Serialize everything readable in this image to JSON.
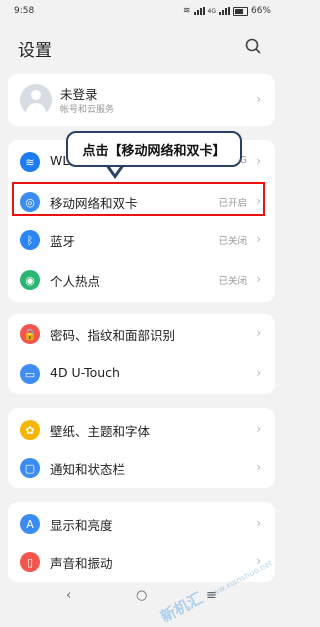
{
  "status_bar": {
    "time": "9:58",
    "network": "4G",
    "battery": "66%"
  },
  "page": {
    "title": "设置"
  },
  "account": {
    "name": "未登录",
    "subtitle": "帐号和云服务"
  },
  "network_group": {
    "wlan": {
      "label": "WLAN",
      "status": "G"
    },
    "mobile": {
      "label": "移动网络和双卡",
      "status": "已开启"
    },
    "bluetooth": {
      "label": "蓝牙",
      "status": "已关闭"
    },
    "hotspot": {
      "label": "个人热点",
      "status": "已关闭"
    }
  },
  "security_group": {
    "password": {
      "label": "密码、指纹和面部识别"
    },
    "utouch": {
      "label": "4D U-Touch"
    }
  },
  "display_group": {
    "wallpaper": {
      "label": "壁纸、主题和字体"
    },
    "notifications": {
      "label": "通知和状态栏"
    }
  },
  "sound_group": {
    "display": {
      "label": "显示和亮度"
    },
    "sound": {
      "label": "声音和振动"
    }
  },
  "annotation": {
    "callout": "点击【移动网络和双卡】"
  },
  "watermark": {
    "text": "新机汇",
    "sub": "www.xianshuo.net"
  },
  "colors": {
    "highlight": "#ee1111",
    "wlan": "#1e7cf2",
    "mobile": "#3a8cf0",
    "bluetooth": "#2b86f2",
    "hotspot": "#2bb673",
    "password": "#f2554b",
    "utouch": "#3f8cf2",
    "wallpaper": "#f6b500",
    "notifications": "#3a8cf0",
    "display_brightness": "#3a8cf0",
    "sound": "#f2554b"
  }
}
